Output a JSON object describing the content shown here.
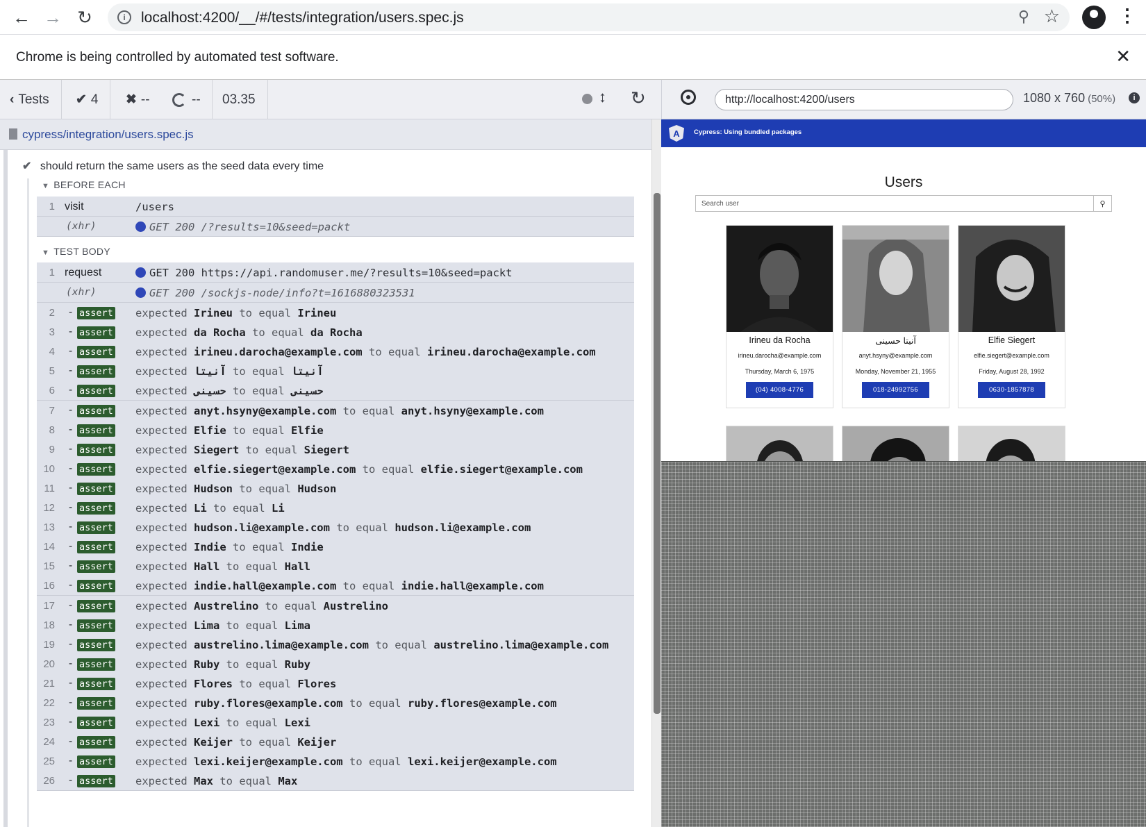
{
  "browser": {
    "url": "localhost:4200/__/#/tests/integration/users.spec.js",
    "info_bar_message": "Chrome is being controlled by automated test software."
  },
  "reporter": {
    "tests_label": "Tests",
    "passed": "4",
    "failed": "--",
    "pending": "--",
    "duration": "03.35",
    "spec_path": "cypress/integration/users.spec.js",
    "test_title": "should return the same users as the seed data every time",
    "before_each_label": "BEFORE EACH",
    "test_body_label": "TEST BODY",
    "before_each": [
      {
        "num": "1",
        "name": "visit",
        "message": "/users"
      },
      {
        "num": "",
        "name": "(xhr)",
        "message": "GET 200 /?results=10&seed=packt"
      }
    ],
    "body_commands": [
      {
        "num": "1",
        "name": "request",
        "message": "GET 200 https://api.randomuser.me/?results=10&seed=packt"
      },
      {
        "num": "",
        "name": "(xhr)",
        "message": "GET 200 /sockjs-node/info?t=1616880323531"
      }
    ],
    "assert_badge": "assert",
    "expected_word": "expected",
    "to_equal_word": "to equal",
    "asserts": [
      {
        "num": "2",
        "actual": "Irineu",
        "expected": "Irineu"
      },
      {
        "num": "3",
        "actual": "da Rocha",
        "expected": "da Rocha"
      },
      {
        "num": "4",
        "actual": "irineu.darocha@example.com",
        "expected": "irineu.darocha@example.com"
      },
      {
        "num": "5",
        "actual": "آنیتا",
        "expected": "آنیتا"
      },
      {
        "num": "6",
        "actual": "حسینی",
        "expected": "حسینی"
      },
      {
        "num": "7",
        "actual": "anyt.hsyny@example.com",
        "expected": "anyt.hsyny@example.com"
      },
      {
        "num": "8",
        "actual": "Elfie",
        "expected": "Elfie"
      },
      {
        "num": "9",
        "actual": "Siegert",
        "expected": "Siegert"
      },
      {
        "num": "10",
        "actual": "elfie.siegert@example.com",
        "expected": "elfie.siegert@example.com"
      },
      {
        "num": "11",
        "actual": "Hudson",
        "expected": "Hudson"
      },
      {
        "num": "12",
        "actual": "Li",
        "expected": "Li"
      },
      {
        "num": "13",
        "actual": "hudson.li@example.com",
        "expected": "hudson.li@example.com"
      },
      {
        "num": "14",
        "actual": "Indie",
        "expected": "Indie"
      },
      {
        "num": "15",
        "actual": "Hall",
        "expected": "Hall"
      },
      {
        "num": "16",
        "actual": "indie.hall@example.com",
        "expected": "indie.hall@example.com"
      },
      {
        "num": "17",
        "actual": "Austrelino",
        "expected": "Austrelino"
      },
      {
        "num": "18",
        "actual": "Lima",
        "expected": "Lima"
      },
      {
        "num": "19",
        "actual": "austrelino.lima@example.com",
        "expected": "austrelino.lima@example.com"
      },
      {
        "num": "20",
        "actual": "Ruby",
        "expected": "Ruby"
      },
      {
        "num": "21",
        "actual": "Flores",
        "expected": "Flores"
      },
      {
        "num": "22",
        "actual": "ruby.flores@example.com",
        "expected": "ruby.flores@example.com"
      },
      {
        "num": "23",
        "actual": "Lexi",
        "expected": "Lexi"
      },
      {
        "num": "24",
        "actual": "Keijer",
        "expected": "Keijer"
      },
      {
        "num": "25",
        "actual": "lexi.keijer@example.com",
        "expected": "lexi.keijer@example.com"
      },
      {
        "num": "26",
        "actual": "Max",
        "expected": "Max"
      }
    ]
  },
  "aut": {
    "url": "http://localhost:4200/users",
    "viewport": "1080 x 760",
    "scale": "(50%)",
    "app_banner": "Cypress: Using bundled packages",
    "page_title": "Users",
    "search_placeholder": "Search user",
    "users": [
      {
        "name": "Irineu da Rocha",
        "email": "irineu.darocha@example.com",
        "dob": "Thursday, March 6, 1975",
        "phone": "(04) 4008-4776"
      },
      {
        "name": "آنیتا حسینی",
        "email": "anyt.hsyny@example.com",
        "dob": "Monday, November 21, 1955",
        "phone": "018-24992756"
      },
      {
        "name": "Elfie Siegert",
        "email": "elfie.siegert@example.com",
        "dob": "Friday, August 28, 1992",
        "phone": "0630-1857878"
      }
    ]
  },
  "colors": {
    "assert_badge": "#2c5c2e",
    "app_primary": "#1e3db3",
    "xhr_dot": "#2f47b8"
  }
}
